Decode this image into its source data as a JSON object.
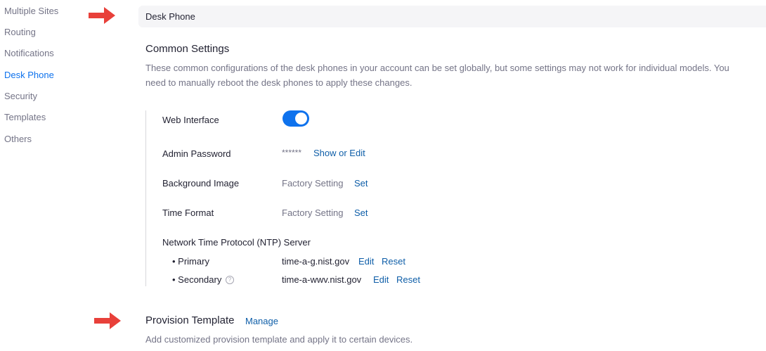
{
  "sidebar": {
    "items": [
      {
        "label": "Multiple Sites"
      },
      {
        "label": "Routing"
      },
      {
        "label": "Notifications"
      },
      {
        "label": "Desk Phone"
      },
      {
        "label": "Security"
      },
      {
        "label": "Templates"
      },
      {
        "label": "Others"
      }
    ],
    "active": "Desk Phone"
  },
  "header": {
    "title": "Desk Phone"
  },
  "common": {
    "title": "Common Settings",
    "desc_line1": "These common configurations of the desk phones in your account can be set globally, but some settings may not work for individual models. You",
    "desc_line2": "need to manually reboot the desk phones to apply these changes."
  },
  "settings": {
    "web_interface": {
      "label": "Web Interface",
      "enabled": true
    },
    "admin_password": {
      "label": "Admin Password",
      "value": "******",
      "action": "Show or Edit"
    },
    "background_image": {
      "label": "Background Image",
      "value": "Factory Setting",
      "action": "Set"
    },
    "time_format": {
      "label": "Time Format",
      "value": "Factory Setting",
      "action": "Set"
    },
    "ntp": {
      "label": "Network Time Protocol (NTP) Server",
      "primary": {
        "label": "• Primary",
        "value": "time-a-g.nist.gov",
        "edit": "Edit",
        "reset": "Reset"
      },
      "secondary": {
        "label": "• Secondary",
        "value": "time-a-wwv.nist.gov",
        "edit": "Edit",
        "reset": "Reset",
        "help": "?"
      }
    }
  },
  "provision": {
    "title": "Provision Template",
    "manage": "Manage",
    "desc": "Add customized provision template and apply it to certain devices."
  },
  "colors": {
    "accent": "#0e72ed",
    "link": "#0e5ea8",
    "arrow": "#e8403a"
  }
}
